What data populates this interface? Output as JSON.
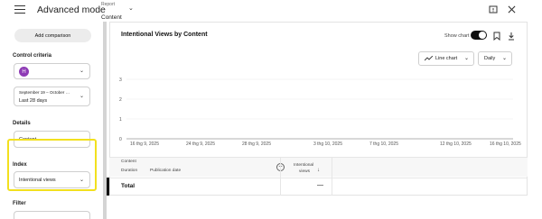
{
  "header": {
    "app_title": "Advanced mode",
    "report_label": "Report",
    "report_value": "Content"
  },
  "sidebar": {
    "add_comparison": "Add comparison",
    "control_criteria_label": "Control criteria",
    "avatar_letter": "H",
    "date_range_line1": "September 19 – October …",
    "date_range_line2": "Last 28 days",
    "details_label": "Details",
    "details_value": "Content",
    "index_label": "Index",
    "index_value": "Intentional views",
    "filter_label": "Filter"
  },
  "chart_panel": {
    "title": "Intentional Views by Content",
    "show_chart_label": "Show chart",
    "chart_type_button": "Line chart",
    "granularity_button": "Daily"
  },
  "chart_data": {
    "type": "line",
    "title": "Intentional Views by Content",
    "ylim": [
      0,
      3
    ],
    "y_ticks": [
      "0",
      "1",
      "2",
      "3"
    ],
    "x_ticks": [
      "16 thg 9, 2025",
      "24 thg 9, 2025",
      "28 thg 9, 2025",
      "3 thg 10, 2025",
      "7 thg 10, 2025",
      "12 thg 10, 2025",
      "16 thg 10, 2025"
    ],
    "series": []
  },
  "table": {
    "col_content_group": "Content",
    "col_duration": "Duration",
    "col_publication_date": "Publication date",
    "col_metric_line1": "Intentional",
    "col_metric_line2": "views",
    "sort_arrow": "↓",
    "total_label": "Total",
    "total_value": "—"
  },
  "colors": {
    "toggle_on": "#0f0f0f",
    "avatar": "#8e3bb5",
    "highlight": "#f2e01e"
  }
}
